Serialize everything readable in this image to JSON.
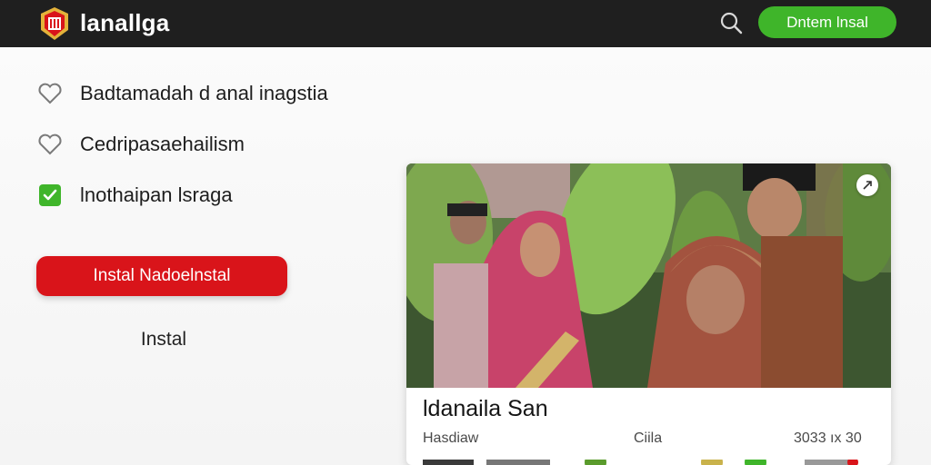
{
  "header": {
    "app_title": "lanallga",
    "cta_label": "Dntem lnsal",
    "logo_icon": "shield-logo-icon",
    "search_icon": "search-icon",
    "colors": {
      "bar": "#1f1f1f",
      "cta": "#3fb52a",
      "logo": "#d9141a"
    }
  },
  "options": [
    {
      "label": "Badtamadah d anal inagstia",
      "icon": "heart-outline-icon",
      "checked": false
    },
    {
      "label": "Cedripasaehailism",
      "icon": "heart-outline-icon",
      "checked": false
    },
    {
      "label": "lnothaipan lsraga",
      "icon": "checkbox-checked-icon",
      "checked": true
    }
  ],
  "actions": {
    "primary_label": "Instal Nadoelnstal",
    "secondary_label": "Instal",
    "primary_color": "#d9141a"
  },
  "card": {
    "title": "ldanaila San",
    "meta_left": "Hasdiaw",
    "meta_mid": "Ciila",
    "meta_right": "3033 ıx 30",
    "badge_icon": "expand-icon"
  }
}
